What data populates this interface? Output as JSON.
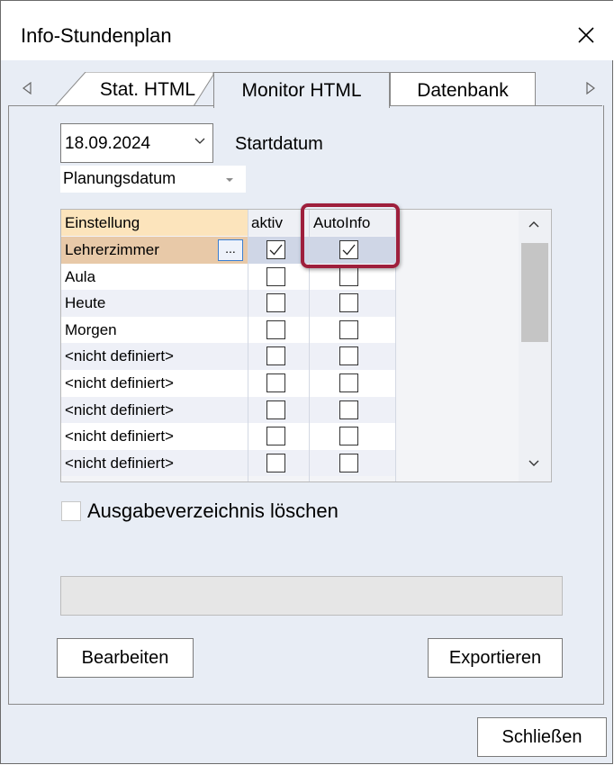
{
  "window": {
    "title": "Info-Stundenplan"
  },
  "tabs": [
    {
      "label": "Stat. HTML"
    },
    {
      "label": "Monitor HTML",
      "active": true
    },
    {
      "label": "Datenbank"
    }
  ],
  "date_field": {
    "value": "18.09.2024",
    "label": "Startdatum"
  },
  "date_type_select": {
    "value": "Planungsdatum"
  },
  "grid": {
    "headers": [
      "Einstellung",
      "aktiv",
      "AutoInfo"
    ],
    "rows": [
      {
        "name": "Lehrerzimmer",
        "aktiv": true,
        "autoinfo": true,
        "has_button": true,
        "button_label": "..."
      },
      {
        "name": "Aula",
        "aktiv": false,
        "autoinfo": false
      },
      {
        "name": "Heute",
        "aktiv": false,
        "autoinfo": false
      },
      {
        "name": "Morgen",
        "aktiv": false,
        "autoinfo": false
      },
      {
        "name": "<nicht definiert>",
        "aktiv": false,
        "autoinfo": false
      },
      {
        "name": "<nicht definiert>",
        "aktiv": false,
        "autoinfo": false
      },
      {
        "name": "<nicht definiert>",
        "aktiv": false,
        "autoinfo": false
      },
      {
        "name": "<nicht definiert>",
        "aktiv": false,
        "autoinfo": false
      },
      {
        "name": "<nicht definiert>",
        "aktiv": false,
        "autoinfo": false
      }
    ]
  },
  "options": {
    "delete_output_dir_label": "Ausgabeverzeichnis löschen",
    "delete_output_dir_checked": false
  },
  "progress": {
    "value": 0
  },
  "buttons": {
    "edit": "Bearbeiten",
    "export": "Exportieren",
    "close": "Schließen"
  },
  "colors": {
    "highlight_border": "#9e1f3c",
    "header_bg": "#fce4bc",
    "selected_row_bg": "#e8c9a8"
  }
}
